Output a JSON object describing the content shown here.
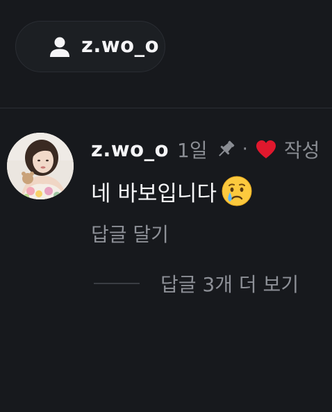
{
  "header": {
    "username": "z.wo_o"
  },
  "comment": {
    "author": "z.wo_o",
    "time": "1일",
    "separator": "·",
    "author_liked_label": "작성",
    "text": "네 바보입니다",
    "emoji": "crying-face",
    "reply_label": "답글 달기",
    "more_replies_label": "답글 3개 더 보기",
    "heart_color": "#e0182d"
  }
}
